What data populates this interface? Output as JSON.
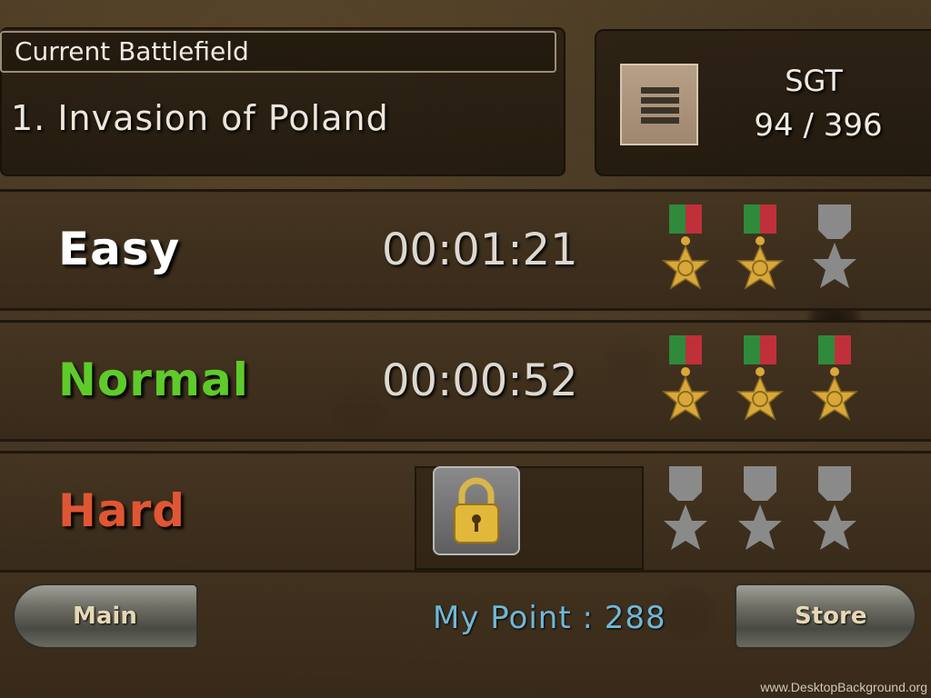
{
  "header": {
    "section_label": "Current Battlefield",
    "battlefield_name": "1. Invasion of Poland"
  },
  "rank": {
    "icon": "rank-insignia-icon",
    "title": "SGT",
    "progress": "94 / 396"
  },
  "difficulties": {
    "easy": {
      "label": "Easy",
      "color": "#ffffff",
      "time": "00:01:21",
      "medals_earned": 2,
      "medals_total": 3
    },
    "normal": {
      "label": "Normal",
      "color": "#5ecb2a",
      "time": "00:00:52",
      "medals_earned": 3,
      "medals_total": 3
    },
    "hard": {
      "label": "Hard",
      "color": "#e05634",
      "locked": true,
      "lock_icon": "padlock-icon",
      "medals_earned": 0,
      "medals_total": 3
    }
  },
  "footer": {
    "main_button": "Main",
    "store_button": "Store",
    "my_point": "My Point : 288"
  },
  "watermark": "www.DesktopBackground.org",
  "colors": {
    "medal_gold": "#d9a838",
    "medal_grey": "#8a8a8a",
    "ribbon_green": "#2f8a3c",
    "ribbon_red": "#c0303a",
    "point_blue": "#6fb8d8"
  }
}
